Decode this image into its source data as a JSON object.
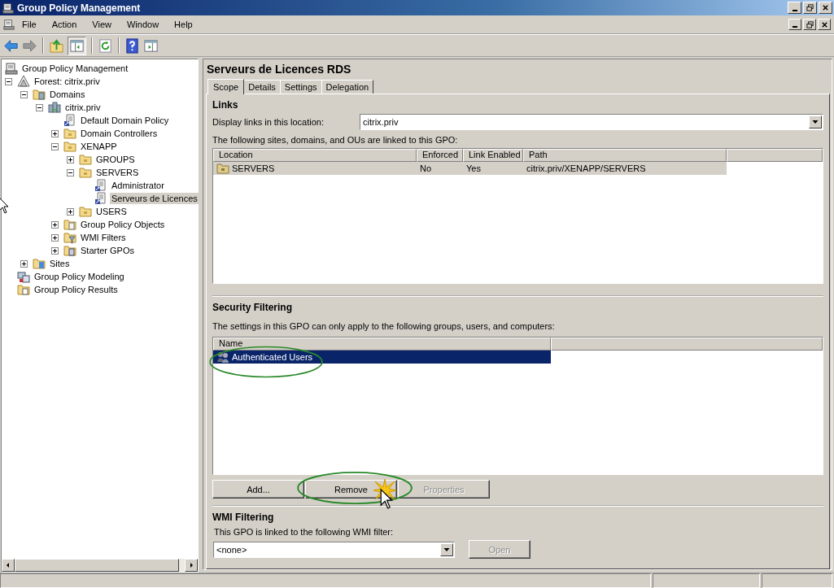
{
  "window": {
    "title": "Group Policy Management"
  },
  "menu": [
    "File",
    "Action",
    "View",
    "Window",
    "Help"
  ],
  "tree": [
    {
      "label": "Group Policy Management",
      "kind": "console",
      "selected": false,
      "children": [
        {
          "label": "Forest: citrix.priv",
          "kind": "forest",
          "expanded": true,
          "selected": false,
          "children": [
            {
              "label": "Domains",
              "kind": "domains",
              "expanded": true,
              "selected": false,
              "children": [
                {
                  "label": "citrix.priv",
                  "kind": "domain",
                  "expanded": true,
                  "selected": false,
                  "children": [
                    {
                      "label": "Default Domain Policy",
                      "kind": "gpo-link",
                      "selected": false
                    },
                    {
                      "label": "Domain Controllers",
                      "kind": "ou",
                      "expanded": false,
                      "selected": false
                    },
                    {
                      "label": "XENAPP",
                      "kind": "ou",
                      "expanded": true,
                      "selected": false,
                      "children": [
                        {
                          "label": "GROUPS",
                          "kind": "ou",
                          "expanded": false,
                          "selected": false
                        },
                        {
                          "label": "SERVERS",
                          "kind": "ou",
                          "expanded": true,
                          "selected": false,
                          "children": [
                            {
                              "label": "Administrator",
                              "kind": "gpo-link",
                              "selected": false
                            },
                            {
                              "label": "Serveurs de Licences",
                              "kind": "gpo-link",
                              "selected": true
                            }
                          ]
                        },
                        {
                          "label": "USERS",
                          "kind": "ou",
                          "expanded": false,
                          "selected": false
                        }
                      ]
                    },
                    {
                      "label": "Group Policy Objects",
                      "kind": "gpo-container",
                      "expanded": false,
                      "selected": false
                    },
                    {
                      "label": "WMI Filters",
                      "kind": "wmi",
                      "expanded": false,
                      "selected": false
                    },
                    {
                      "label": "Starter GPOs",
                      "kind": "starter",
                      "expanded": false,
                      "selected": false
                    }
                  ]
                }
              ]
            },
            {
              "label": "Sites",
              "kind": "sites",
              "expanded": false,
              "selected": false
            }
          ]
        },
        {
          "label": "Group Policy Modeling",
          "kind": "modeling",
          "selected": false
        },
        {
          "label": "Group Policy Results",
          "kind": "results",
          "selected": false
        }
      ]
    }
  ],
  "details": {
    "title": "Serveurs de Licences RDS",
    "tabs": [
      {
        "label": "Scope",
        "selected": true
      },
      {
        "label": "Details",
        "selected": false
      },
      {
        "label": "Settings",
        "selected": false
      },
      {
        "label": "Delegation",
        "selected": false
      }
    ],
    "links": {
      "heading": "Links",
      "location_label": "Display links in this location:",
      "location_value": "citrix.priv",
      "description": "The following sites, domains, and OUs are linked to this GPO:",
      "columns": [
        "Location",
        "Enforced",
        "Link Enabled",
        "Path"
      ],
      "rows": [
        {
          "cells": [
            "SERVERS",
            "No",
            "Yes",
            "citrix.priv/XENAPP/SERVERS"
          ],
          "selected": true
        }
      ]
    },
    "security_filtering": {
      "heading": "Security Filtering",
      "description": "The settings in this GPO can only apply to the following groups, users, and computers:",
      "columns": [
        "Name"
      ],
      "rows": [
        {
          "name": "Authenticated Users",
          "selected": true
        }
      ],
      "buttons": [
        {
          "label": "Add...",
          "disabled": false
        },
        {
          "label": "Remove",
          "disabled": false
        },
        {
          "label": "Properties",
          "disabled": true
        }
      ]
    },
    "wmi_filtering": {
      "heading": "WMI Filtering",
      "label": "This GPO is linked to the following WMI filter:",
      "value": "<none>",
      "button": {
        "label": "Open",
        "disabled": true
      }
    }
  }
}
